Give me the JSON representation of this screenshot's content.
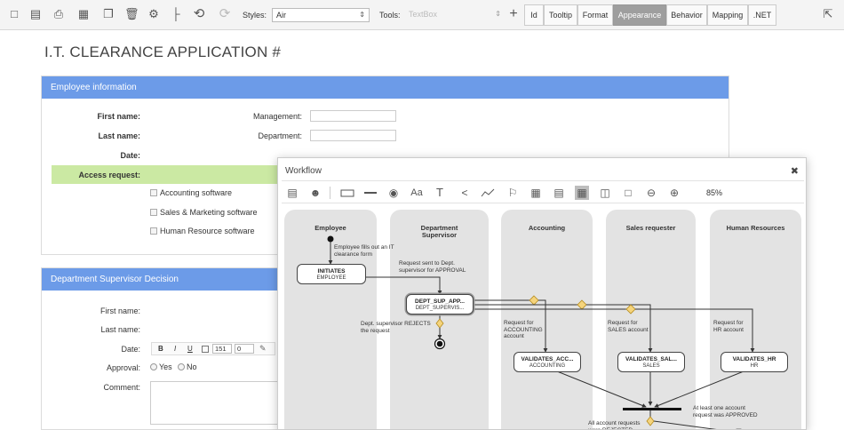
{
  "toolbar": {
    "icons": [
      "page-icon",
      "save-icon",
      "print-icon",
      "add-grid-icon",
      "window-icon",
      "trash-icon",
      "gear-icon",
      "tree-icon",
      "undo-icon",
      "redo-icon"
    ],
    "styles_label": "Styles:",
    "styles_value": "Air",
    "tools_label": "Tools:",
    "tools_value": "TextBox",
    "tabs": [
      "Id",
      "Tooltip",
      "Format",
      "Appearance",
      "Behavior",
      "Mapping",
      ".NET"
    ],
    "active_tab": "Appearance"
  },
  "form": {
    "title": "I.T. CLEARANCE APPLICATION #",
    "employee_section": {
      "header": "Employee information",
      "first_name": "First name:",
      "last_name": "Last name:",
      "date": "Date:",
      "management": "Management:",
      "department": "Department:",
      "access_request": "Access request:",
      "software": [
        "Accounting software",
        "Sales & Marketing software",
        "Human Resource software"
      ]
    },
    "supervisor_section": {
      "header": "Department Supervisor Decision",
      "first_name": "First name:",
      "last_name": "Last name:",
      "date": "Date:",
      "approval": "Approval:",
      "yes": "Yes",
      "no": "No",
      "comment": "Comment:",
      "fmt_bold": "B",
      "fmt_italic": "I",
      "fmt_underline": "U",
      "font_size": "151",
      "zero": "0"
    }
  },
  "workflow": {
    "title": "Workflow",
    "zoom": "85%",
    "lanes": [
      "Employee",
      "Department Supervisor",
      "Accounting",
      "Sales requester",
      "Human Resources"
    ],
    "nodes": [
      {
        "title": "INITIATES",
        "sub": "EMPLOYEE"
      },
      {
        "title": "DEPT_SUP_APP...",
        "sub": "DEPT_SUPERVIS..."
      },
      {
        "title": "VALIDATES_ACC...",
        "sub": "ACCOUNTING"
      },
      {
        "title": "VALIDATES_SAL...",
        "sub": "SALES"
      },
      {
        "title": "VALIDATES_HR",
        "sub": "HR"
      }
    ],
    "notes": {
      "fills_form": "Employee fills out an IT clearance form",
      "sent_to_dept": "Request sent to Dept. supervisor for APPROVAL",
      "rejects": "Dept. supervisor REJECTS the request",
      "req_accounting": "Request for ACCOUNTING account",
      "req_sales": "Request for SALES account",
      "req_hr": "Request for HR account",
      "at_least_one": "At least one account request was APPROVED",
      "all_requests": "All account requests were REJECTED"
    }
  }
}
